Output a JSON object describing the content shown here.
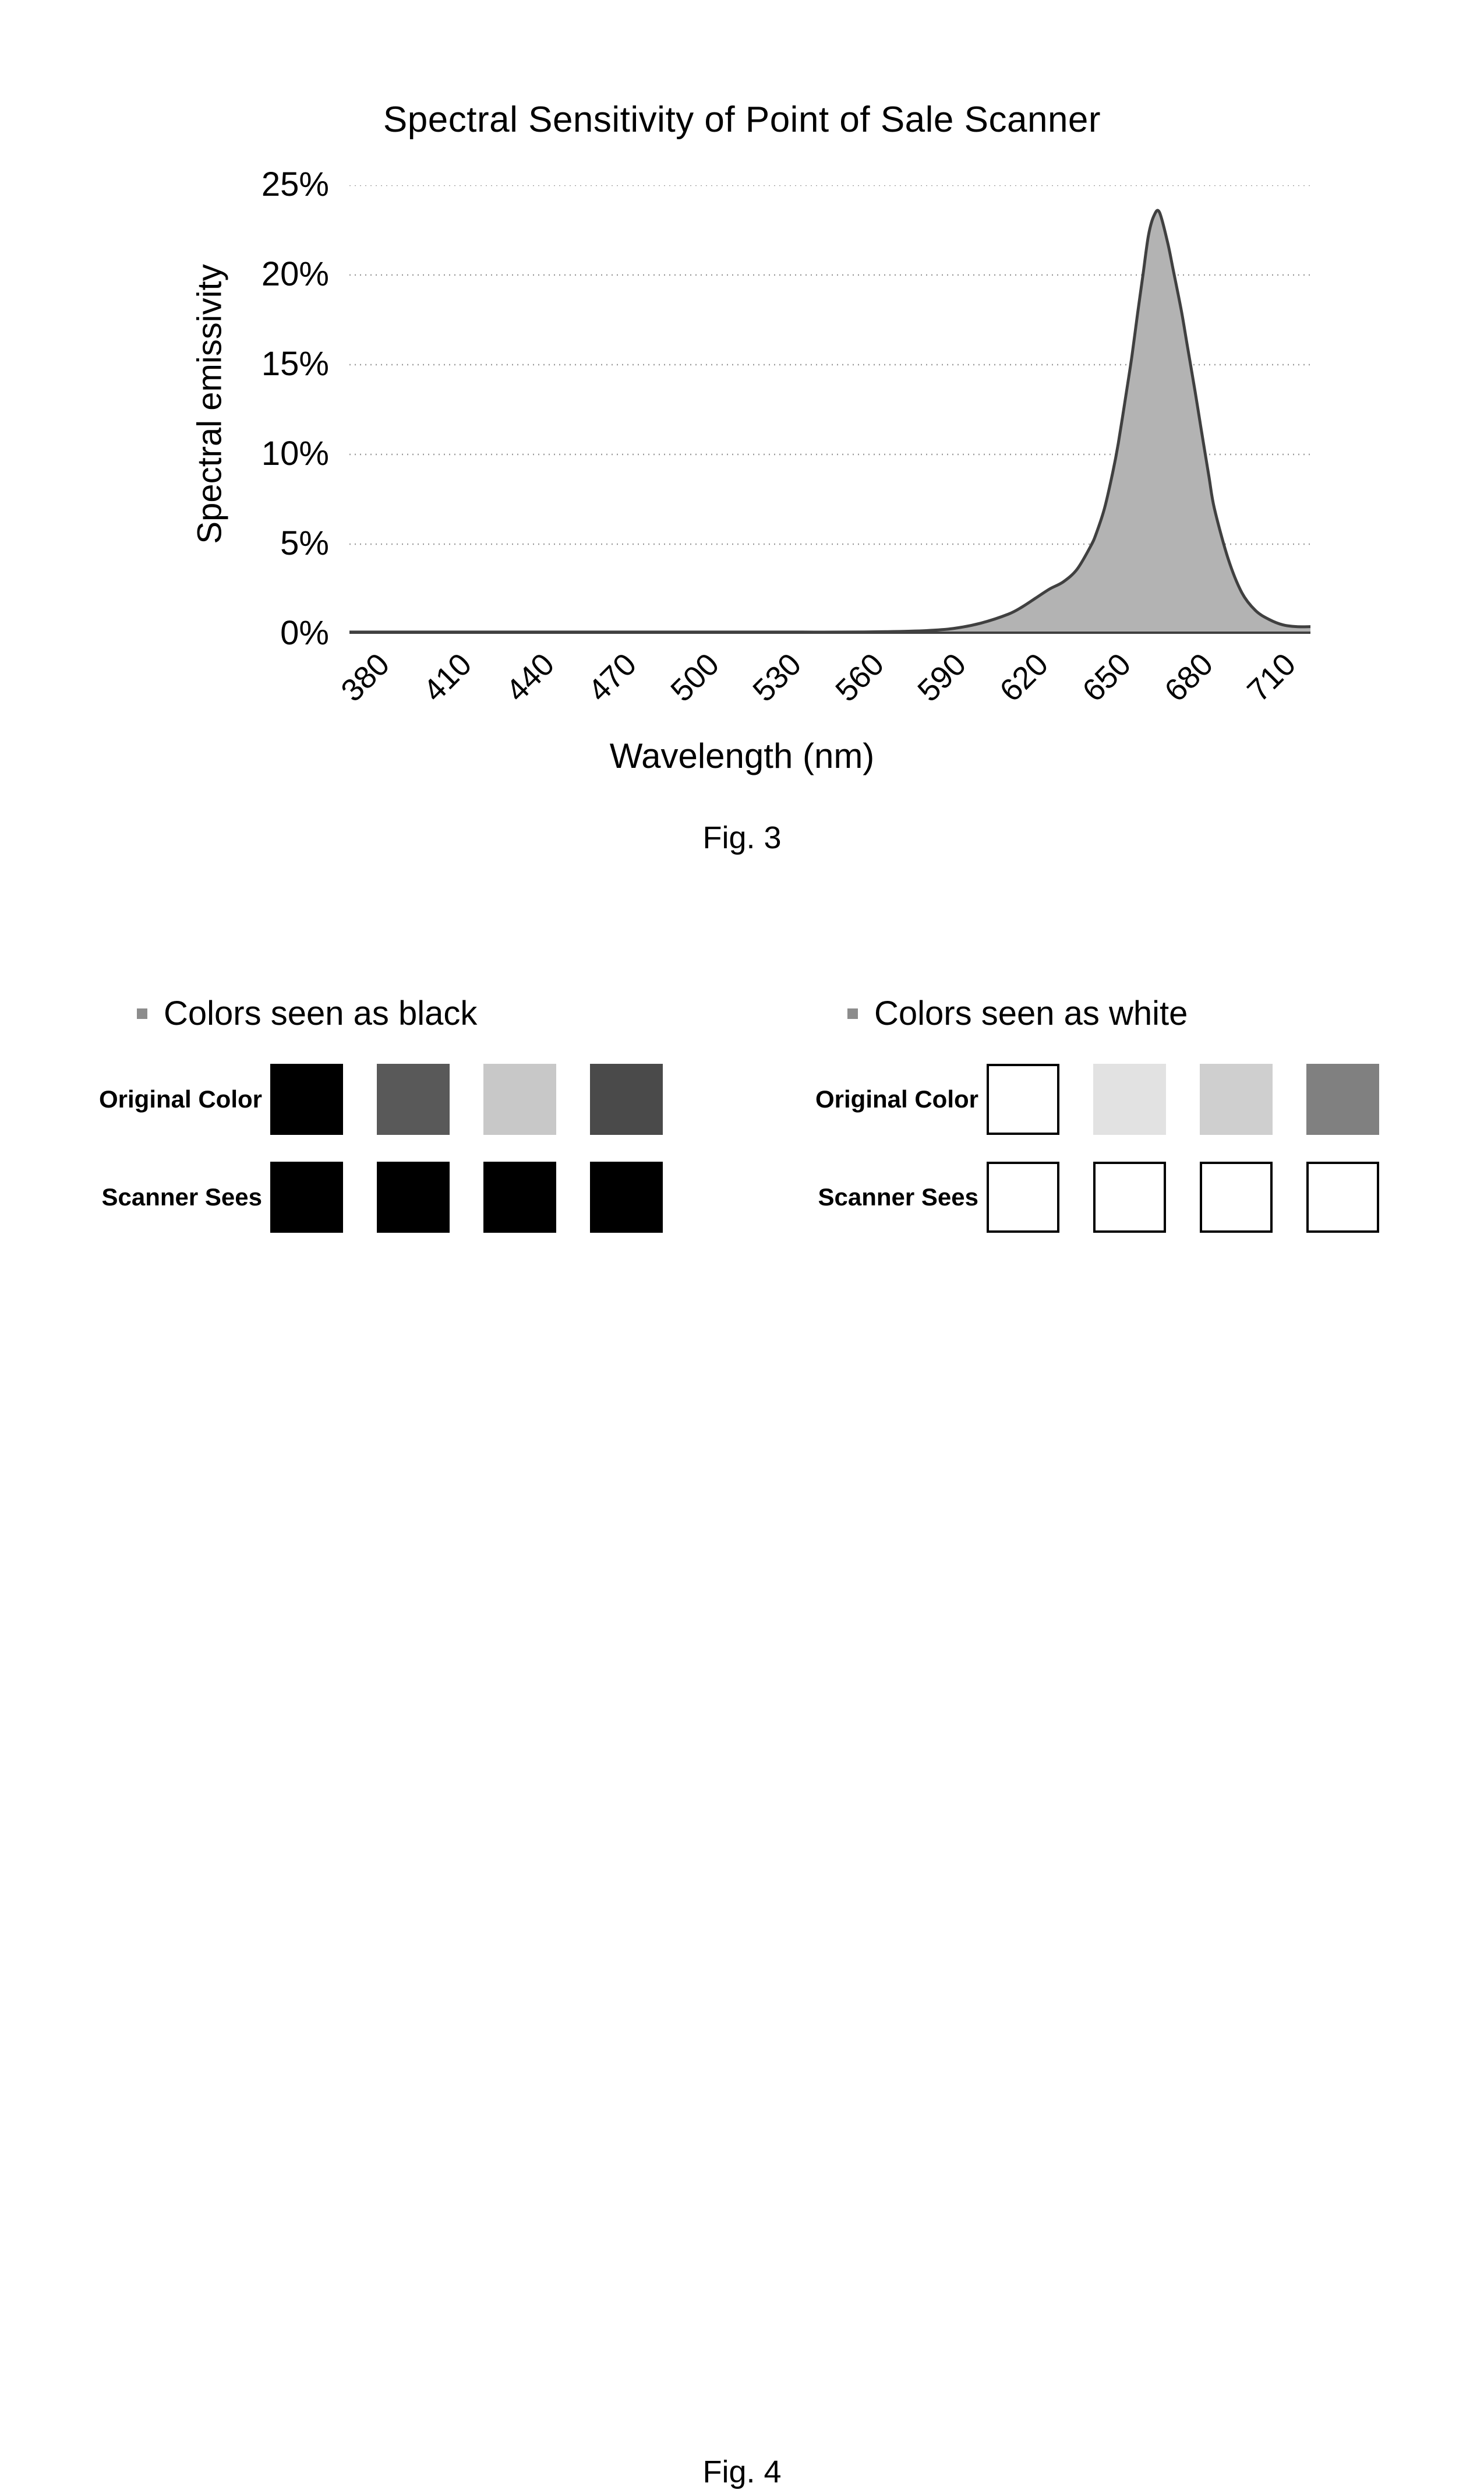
{
  "figure3": {
    "caption": "Fig. 3",
    "chart_data": {
      "type": "area",
      "title": "Spectral Sensitivity of Point of Sale Scanner",
      "xlabel": "Wavelength (nm)",
      "ylabel": "Spectral emissivity",
      "xtick_labels": [
        "380",
        "410",
        "440",
        "470",
        "500",
        "530",
        "560",
        "590",
        "620",
        "650",
        "680",
        "710"
      ],
      "ytick_labels": [
        "0%",
        "5%",
        "10%",
        "15%",
        "20%",
        "25%"
      ],
      "ylim": [
        0,
        25
      ],
      "xlim": [
        380,
        730
      ],
      "grid": "horizontal-dotted",
      "legend": "none",
      "series_name": "Spectral emissivity",
      "fill_color": "#b3b3b3",
      "line_color": "#404040",
      "x": [
        380,
        395,
        410,
        425,
        440,
        455,
        470,
        485,
        500,
        515,
        530,
        545,
        560,
        575,
        590,
        600,
        610,
        620,
        625,
        630,
        635,
        640,
        645,
        650,
        652,
        655,
        658,
        660,
        663,
        665,
        667,
        669,
        671,
        673,
        675,
        678,
        680,
        683,
        685,
        688,
        690,
        693,
        695,
        700,
        705,
        710,
        715,
        720,
        725,
        730
      ],
      "values": [
        0.1,
        0.1,
        0.1,
        0.1,
        0.1,
        0.1,
        0.1,
        0.1,
        0.1,
        0.1,
        0.1,
        0.1,
        0.1,
        0.12,
        0.18,
        0.3,
        0.6,
        1.1,
        1.5,
        2.0,
        2.5,
        2.9,
        3.6,
        4.9,
        5.6,
        7.0,
        9.0,
        10.6,
        13.5,
        15.5,
        17.8,
        20.0,
        22.2,
        23.3,
        23.5,
        21.8,
        20.3,
        18.0,
        16.2,
        13.5,
        11.6,
        8.8,
        7.0,
        4.2,
        2.3,
        1.3,
        0.8,
        0.5,
        0.4,
        0.4
      ]
    }
  },
  "figure4": {
    "caption": "Fig. 4",
    "groups": [
      {
        "title": "Colors seen as black",
        "bullet_icon": "square-bullet-icon",
        "rows": [
          {
            "label": "Original Color",
            "swatches": [
              {
                "color": "#000000",
                "bordered": false
              },
              {
                "color": "#595959",
                "bordered": false
              },
              {
                "color": "#c8c8c8",
                "bordered": false
              },
              {
                "color": "#4a4a4a",
                "bordered": false
              }
            ]
          },
          {
            "label": "Scanner Sees",
            "swatches": [
              {
                "color": "#000000",
                "bordered": false
              },
              {
                "color": "#000000",
                "bordered": false
              },
              {
                "color": "#000000",
                "bordered": false
              },
              {
                "color": "#000000",
                "bordered": false
              }
            ]
          }
        ]
      },
      {
        "title": "Colors seen as white",
        "bullet_icon": "square-bullet-icon",
        "rows": [
          {
            "label": "Original Color",
            "swatches": [
              {
                "color": "#ffffff",
                "bordered": true
              },
              {
                "color": "#e2e2e2",
                "bordered": false
              },
              {
                "color": "#cfcfcf",
                "bordered": false
              },
              {
                "color": "#808080",
                "bordered": false
              }
            ]
          },
          {
            "label": "Scanner Sees",
            "swatches": [
              {
                "color": "#ffffff",
                "bordered": true
              },
              {
                "color": "#ffffff",
                "bordered": true
              },
              {
                "color": "#ffffff",
                "bordered": true
              },
              {
                "color": "#ffffff",
                "bordered": true
              }
            ]
          }
        ]
      }
    ]
  }
}
